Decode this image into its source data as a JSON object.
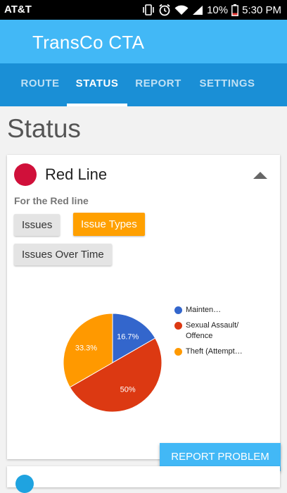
{
  "status_bar": {
    "carrier": "AT&T",
    "battery": "10%",
    "time": "5:30 PM"
  },
  "app": {
    "title": "TransCo CTA"
  },
  "tabs": [
    {
      "label": "ROUTE"
    },
    {
      "label": "STATUS"
    },
    {
      "label": "REPORT"
    },
    {
      "label": "SETTINGS"
    }
  ],
  "page": {
    "title": "Status"
  },
  "line_card": {
    "name": "Red Line",
    "color": "#d0103a",
    "subtitle": "For the Red line",
    "buttons": [
      {
        "label": "Issues"
      },
      {
        "label": "Issue Types"
      },
      {
        "label": "Issues Over Time"
      }
    ],
    "selected_button_color": "#ffa000"
  },
  "chart_data": {
    "type": "pie",
    "slices": [
      {
        "label": "Mainten…",
        "value": 16.7,
        "display": "16.7%",
        "color": "#3366cc"
      },
      {
        "label": "Sexual Assault/ Offence",
        "value": 50,
        "display": "50%",
        "color": "#dc3912"
      },
      {
        "label": "Theft (Attempt…",
        "value": 33.3,
        "display": "33.3%",
        "color": "#ff9900"
      }
    ],
    "legend_position": "right"
  },
  "report_button": {
    "label": "REPORT PROBLEM",
    "color": "#42b8f6"
  },
  "next_card": {
    "dot_color": "#1fa3e0"
  },
  "colors": {
    "app_bar": "#42b8f6",
    "tab_bar": "#1a8fd6"
  }
}
